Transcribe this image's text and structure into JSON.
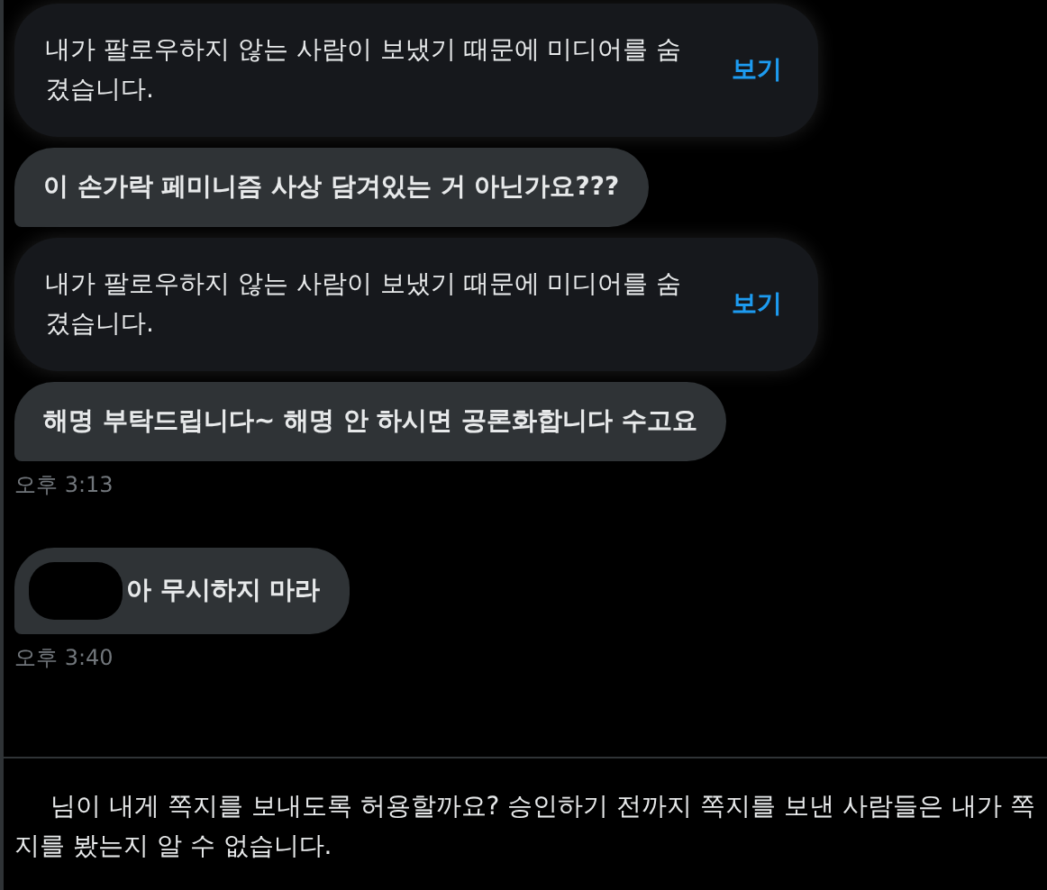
{
  "messages": [
    {
      "kind": "hidden_media",
      "text": "내가 팔로우하지 않는 사람이 보냈기 때문에 미디어를 숨겼습니다.",
      "action": "보기"
    },
    {
      "kind": "text",
      "text": "이 손가락 페미니즘 사상 담겨있는 거 아닌가요???",
      "redacted": false
    },
    {
      "kind": "hidden_media",
      "text": "내가 팔로우하지 않는 사람이 보냈기 때문에 미디어를 숨겼습니다.",
      "action": "보기"
    },
    {
      "kind": "text",
      "text": "해명 부탁드립니다~ 해명 안 하시면 공론화합니다 수고요",
      "redacted": false
    },
    {
      "kind": "time",
      "text": "오후 3:13"
    },
    {
      "kind": "text",
      "text": "아 무시하지 마라",
      "redacted": true
    },
    {
      "kind": "time",
      "text": "오후 3:40"
    }
  ],
  "request_notice": "님이 내게 쪽지를 보내도록 허용할까요? 승인하기 전까지 쪽지를 보낸 사람들은 내가 쪽지를 봤는지 알 수 없습니다."
}
